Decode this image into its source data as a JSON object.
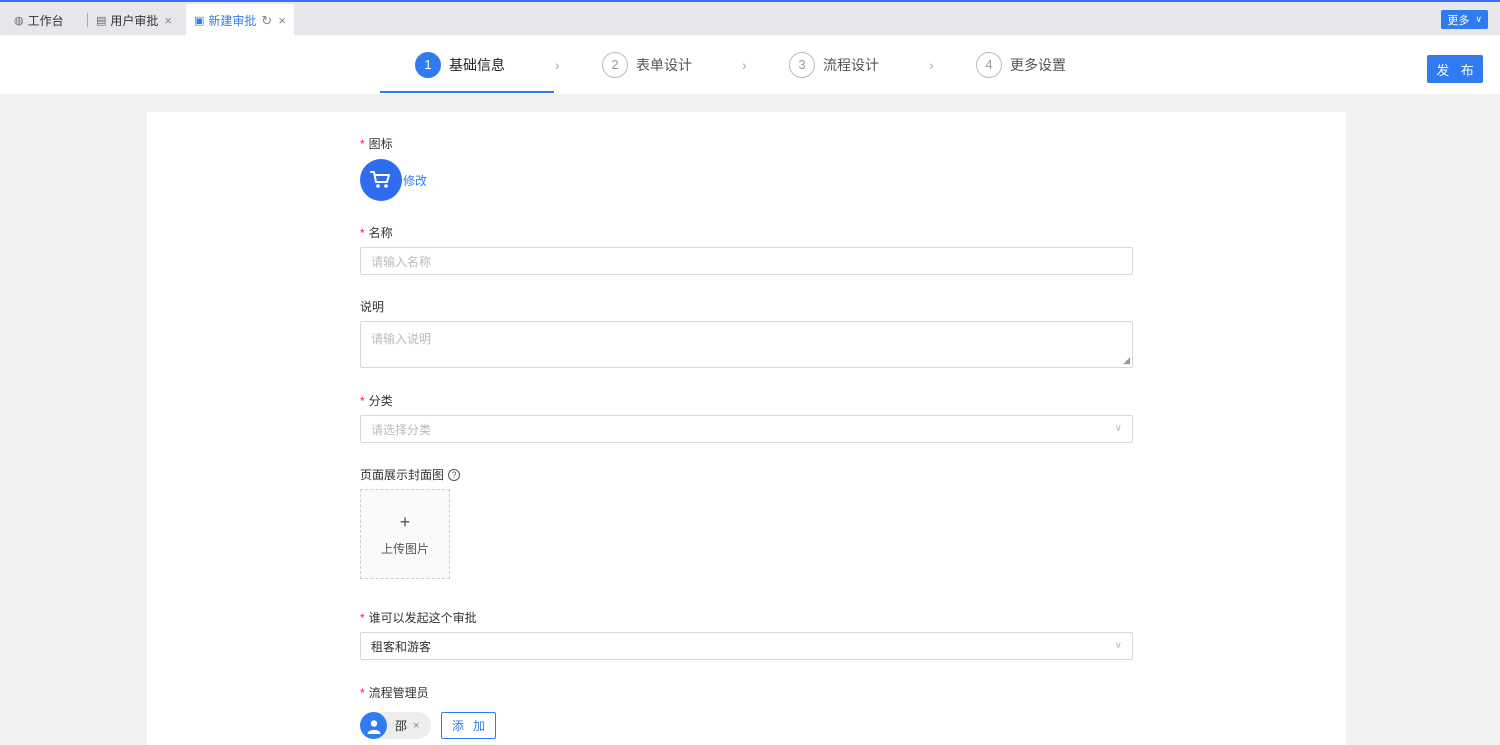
{
  "tabs": [
    {
      "label": "工作台",
      "icon": "dashboard-icon"
    },
    {
      "label": "用户审批",
      "icon": "document-icon"
    },
    {
      "label": "新建审批",
      "icon": "form-icon"
    }
  ],
  "tabbar": {
    "more_label": "更多"
  },
  "steps": [
    {
      "num": "1",
      "label": "基础信息"
    },
    {
      "num": "2",
      "label": "表单设计"
    },
    {
      "num": "3",
      "label": "流程设计"
    },
    {
      "num": "4",
      "label": "更多设置"
    }
  ],
  "header": {
    "publish_label": "发 布"
  },
  "form": {
    "icon_label": "图标",
    "icon_modify": "修改",
    "name_label": "名称",
    "name_placeholder": "请输入名称",
    "desc_label": "说明",
    "desc_placeholder": "请输入说明",
    "category_label": "分类",
    "category_placeholder": "请选择分类",
    "cover_label": "页面展示封面图",
    "upload_plus": "+",
    "upload_label": "上传图片",
    "initiator_label": "谁可以发起这个审批",
    "initiator_value": "租客和游客",
    "admin_label": "流程管理员",
    "admin_tag_name": "邵",
    "add_label": "添 加"
  },
  "colors": {
    "accent": "#2f7cf0",
    "required": "#f5222d"
  }
}
